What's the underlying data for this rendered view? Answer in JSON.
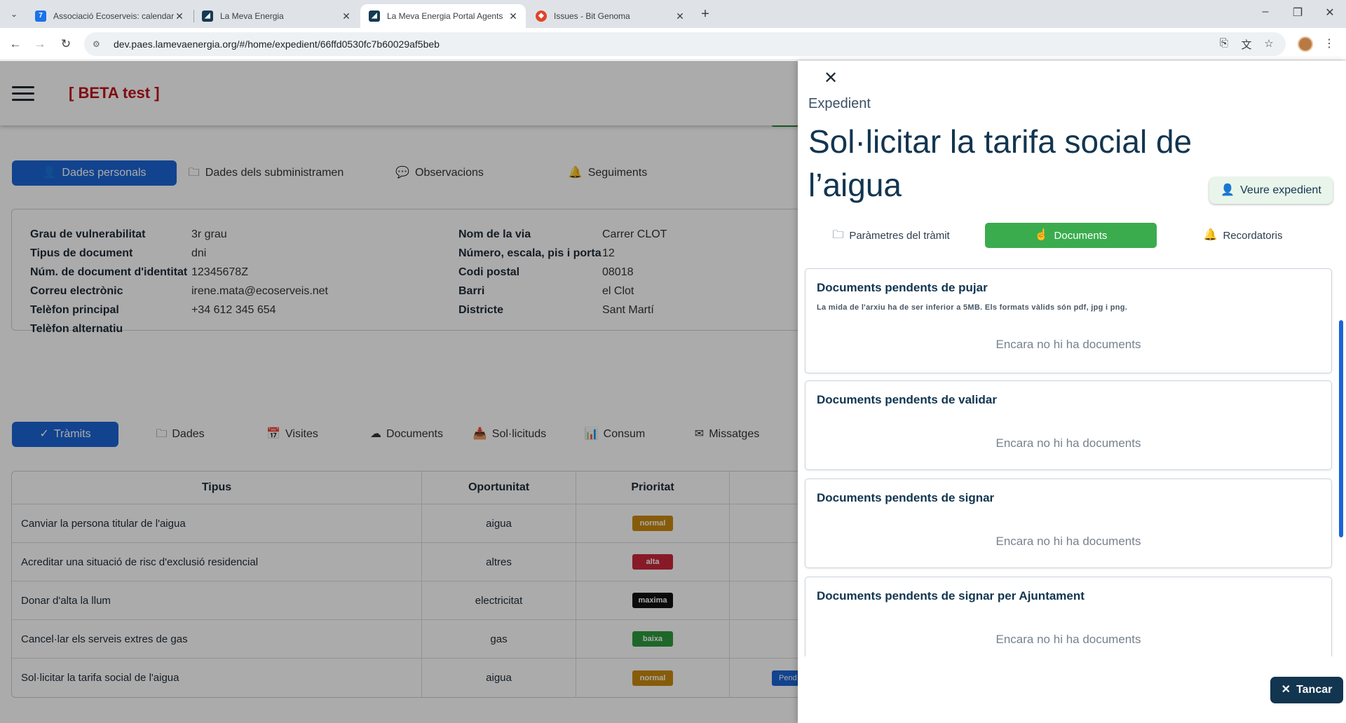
{
  "browser": {
    "tabs": [
      {
        "title": "Associació Ecoserveis: calendari",
        "favicon": "7",
        "favicon_color": "#1a73e8"
      },
      {
        "title": "La Meva Energia",
        "favicon": "",
        "favicon_color": "#163a52"
      },
      {
        "title": "La Meva Energia Portal Agents",
        "favicon": "",
        "favicon_color": "#163a52"
      },
      {
        "title": "Issues - Bit Genoma",
        "favicon": "",
        "favicon_color": "#e24329"
      }
    ],
    "url": "dev.paes.lamevaenergia.org/#/home/expedient/66ffd0530fc7b60029af5beb"
  },
  "app": {
    "beta_label": "[ BETA test ]",
    "profile_tabs": [
      {
        "label": "Dades personals",
        "icon": "user-icon"
      },
      {
        "label": "Dades dels subministramen",
        "icon": "folder-icon"
      },
      {
        "label": "Observacions",
        "icon": "chat-icon"
      },
      {
        "label": "Seguiments",
        "icon": "bell-icon"
      }
    ],
    "info_left": [
      {
        "label": "Grau de vulnerabilitat",
        "value": "3r grau"
      },
      {
        "label": "Tipus de document",
        "value": "dni"
      },
      {
        "label": "Núm. de document d'identitat",
        "value": "12345678Z"
      },
      {
        "label": "Correu electrònic",
        "value": "irene.mata@ecoserveis.net"
      },
      {
        "label": "Telèfon principal",
        "value": "+34 612 345 654"
      },
      {
        "label": "Telèfon alternatiu",
        "value": ""
      }
    ],
    "info_right": [
      {
        "label": "Nom de la via",
        "value": "Carrer CLOT"
      },
      {
        "label": "Número, escala, pis i porta",
        "value": "12"
      },
      {
        "label": "Codi postal",
        "value": "08018"
      },
      {
        "label": "Barri",
        "value": "el Clot"
      },
      {
        "label": "Districte",
        "value": "Sant Martí"
      }
    ],
    "section_tabs": [
      {
        "label": "Tràmits",
        "icon": "check-icon"
      },
      {
        "label": "Dades",
        "icon": "folder-icon"
      },
      {
        "label": "Visites",
        "icon": "calendar-icon"
      },
      {
        "label": "Documents",
        "icon": "cloud-upload-icon"
      },
      {
        "label": "Sol·licituds",
        "icon": "inbox-icon"
      },
      {
        "label": "Consum",
        "icon": "bar-chart-icon"
      },
      {
        "label": "Missatges",
        "icon": "mail-icon"
      }
    ],
    "table": {
      "headers": [
        "Tipus",
        "Oportunitat",
        "Prioritat"
      ],
      "rows": [
        {
          "tipus": "Canviar la persona titular de l'aigua",
          "oportunitat": "aigua",
          "prioritat": "normal",
          "color": "#c98a0e"
        },
        {
          "tipus": "Acreditar una situació de risc d'exclusió residencial",
          "oportunitat": "altres",
          "prioritat": "alta",
          "color": "#c9283a"
        },
        {
          "tipus": "Donar d'alta la llum",
          "oportunitat": "electricitat",
          "prioritat": "maxima",
          "color": "#111111"
        },
        {
          "tipus": "Cancel·lar els serveis extres de gas",
          "oportunitat": "gas",
          "prioritat": "baixa",
          "color": "#2e9a3e"
        },
        {
          "tipus": "Sol·licitar la tarifa social de l'aigua",
          "oportunitat": "aigua",
          "prioritat": "normal",
          "color": "#c98a0e",
          "status": "Pend"
        }
      ]
    }
  },
  "drawer": {
    "kicker": "Expedient",
    "title": "Sol·licitar la tarifa social de l’aigua",
    "veure_label": "Veure expedient",
    "tabs": [
      {
        "label": "Paràmetres del tràmit",
        "icon": "folder-icon"
      },
      {
        "label": "Documents",
        "icon": "hand-icon"
      },
      {
        "label": "Recordatoris",
        "icon": "bell-icon"
      }
    ],
    "sections": [
      {
        "title": "Documents pendents de pujar",
        "hint": "La mida de l'arxiu ha de ser inferior a 5MB. Els formats vàlids són pdf, jpg i png.",
        "empty": "Encara no hi ha documents"
      },
      {
        "title": "Documents pendents de validar",
        "empty": "Encara no hi ha documents"
      },
      {
        "title": "Documents pendents de signar",
        "empty": "Encara no hi ha documents"
      },
      {
        "title": "Documents pendents de signar per Ajuntament",
        "empty": "Encara no hi ha documents"
      }
    ],
    "close_label": "Tancar"
  }
}
